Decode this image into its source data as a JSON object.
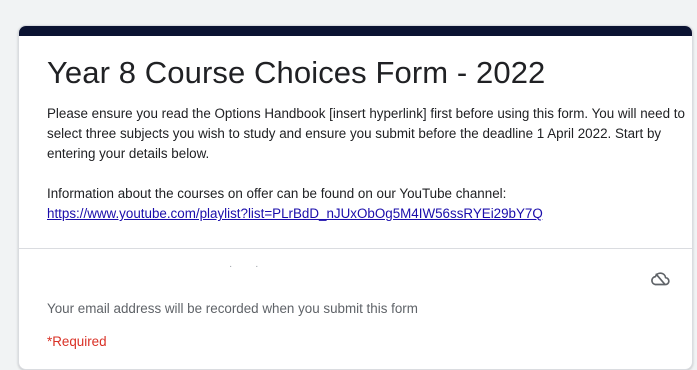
{
  "form": {
    "title": "Year 8 Course Choices Form - 2022",
    "description_p1": "Please ensure you read the Options Handbook [insert hyperlink] first before using this form. You will need to select three subjects you wish to study and ensure you submit before the deadline 1 April 2022. Start by entering your details below.",
    "description_p2": "Information about the courses on offer can be found on our YouTube channel:",
    "youtube_link": "https://www.youtube.com/playlist?list=PLrBdD_nJUxObOg5M4IW56ssRYEi29bY7Q"
  },
  "meta": {
    "email_note": "Your email address will be recorded when you submit this form",
    "required_label": "*Required",
    "cloud_icon": "cloud-not-saved-icon"
  },
  "colors": {
    "accent": "#0b1332",
    "required": "#d93025",
    "link": "#1a0dab"
  }
}
